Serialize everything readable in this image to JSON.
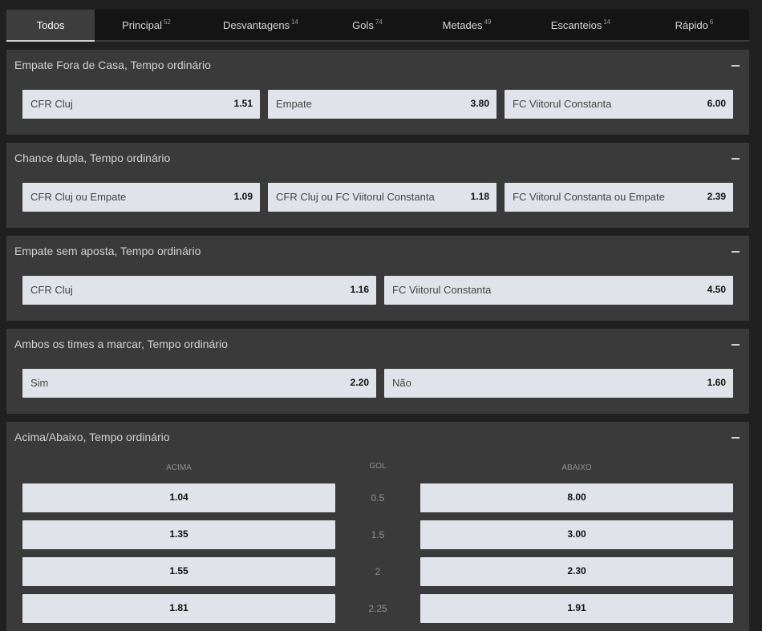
{
  "tabs": [
    {
      "label": "Todos",
      "count": ""
    },
    {
      "label": "Principal",
      "count": "52"
    },
    {
      "label": "Desvantagens",
      "count": "14"
    },
    {
      "label": "Gols",
      "count": "74"
    },
    {
      "label": "Metades",
      "count": "49"
    },
    {
      "label": "Escanteios",
      "count": "14"
    },
    {
      "label": "Rápido",
      "count": "6"
    }
  ],
  "markets": {
    "draw_no_bet_away": {
      "title": "Empate Fora de Casa, Tempo ordinário",
      "options": [
        {
          "name": "CFR Cluj",
          "price": "1.51"
        },
        {
          "name": "Empate",
          "price": "3.80"
        },
        {
          "name": "FC Viitorul Constanta",
          "price": "6.00"
        }
      ]
    },
    "double_chance": {
      "title": "Chance dupla, Tempo ordinário",
      "options": [
        {
          "name": "CFR Cluj ou Empate",
          "price": "1.09"
        },
        {
          "name": "CFR Cluj ou FC Viitorul Constanta",
          "price": "1.18"
        },
        {
          "name": "FC Viitorul Constanta ou Empate",
          "price": "2.39"
        }
      ]
    },
    "draw_no_bet": {
      "title": "Empate sem aposta, Tempo ordinário",
      "options": [
        {
          "name": "CFR Cluj",
          "price": "1.16"
        },
        {
          "name": "FC Viitorul Constanta",
          "price": "4.50"
        }
      ]
    },
    "btts": {
      "title": "Ambos os times a marcar, Tempo ordinário",
      "options": [
        {
          "name": "Sim",
          "price": "2.20"
        },
        {
          "name": "Não",
          "price": "1.60"
        }
      ]
    },
    "over_under": {
      "title": "Acima/Abaixo, Tempo ordinário",
      "col_over": "ACIMA",
      "col_line": "GOL",
      "col_under": "ABAIXO",
      "rows": [
        {
          "over": "1.04",
          "line": "0.5",
          "under": "8.00"
        },
        {
          "over": "1.35",
          "line": "1.5",
          "under": "3.00"
        },
        {
          "over": "1.55",
          "line": "2",
          "under": "2.30"
        },
        {
          "over": "1.81",
          "line": "2.25",
          "under": "1.91"
        }
      ]
    }
  }
}
